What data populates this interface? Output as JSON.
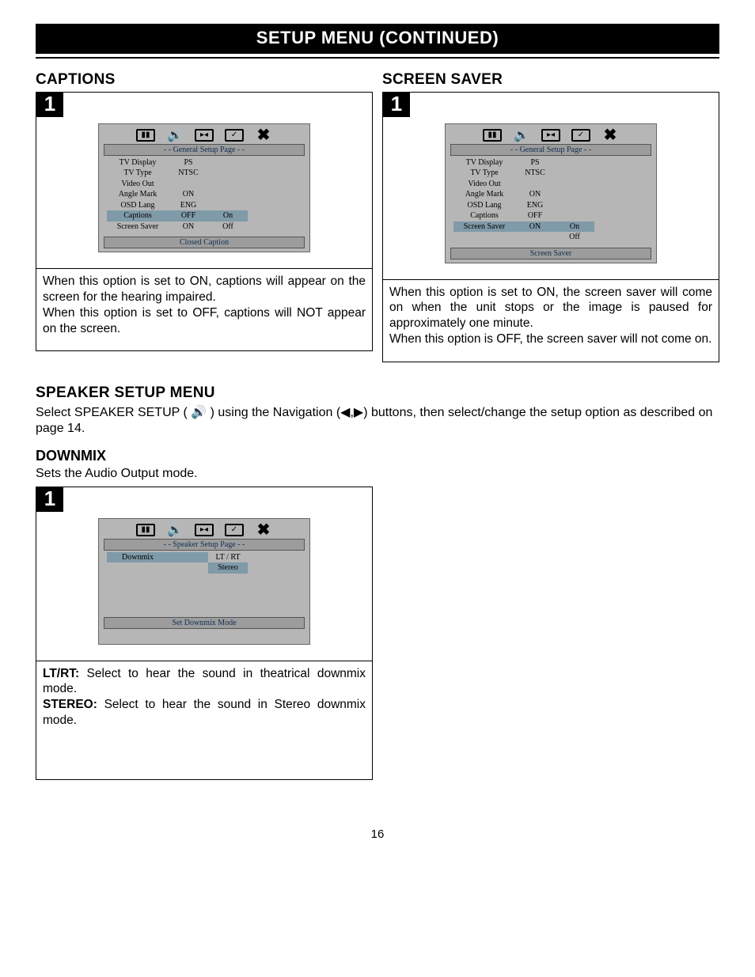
{
  "title": "SETUP MENU (CONTINUED)",
  "pageNumber": "16",
  "captions": {
    "heading": "CAPTIONS",
    "step": "1",
    "osd": {
      "header": "- - General Setup Page - -",
      "rows": [
        {
          "c1": "TV Display",
          "c2": "PS",
          "c3": ""
        },
        {
          "c1": "TV Type",
          "c2": "NTSC",
          "c3": ""
        },
        {
          "c1": "Video Out",
          "c2": "",
          "c3": ""
        },
        {
          "c1": "Angle Mark",
          "c2": "ON",
          "c3": ""
        },
        {
          "c1": "OSD Lang",
          "c2": "ENG",
          "c3": ""
        },
        {
          "c1": "Captions",
          "c2": "OFF",
          "c3": "On",
          "hlLeft": true,
          "hlC3": true
        },
        {
          "c1": "Screen Saver",
          "c2": "ON",
          "c3": "Off"
        }
      ],
      "footer": "Closed Caption"
    },
    "desc1": "When this option is set to ON, captions will appear on the screen for the hearing impaired.",
    "desc2": "When this option is set to OFF, captions will NOT appear on the screen."
  },
  "screenSaver": {
    "heading": "SCREEN SAVER",
    "step": "1",
    "osd": {
      "header": "- - General Setup Page - -",
      "rows": [
        {
          "c1": "TV Display",
          "c2": "PS",
          "c3": ""
        },
        {
          "c1": "TV Type",
          "c2": "NTSC",
          "c3": ""
        },
        {
          "c1": "Video Out",
          "c2": "",
          "c3": ""
        },
        {
          "c1": "Angle Mark",
          "c2": "ON",
          "c3": ""
        },
        {
          "c1": "OSD Lang",
          "c2": "ENG",
          "c3": ""
        },
        {
          "c1": "Captions",
          "c2": "OFF",
          "c3": ""
        },
        {
          "c1": "Screen Saver",
          "c2": "ON",
          "c3": "On",
          "hlLeft": true,
          "hlC3": true
        },
        {
          "c1": "",
          "c2": "",
          "c3": "Off"
        }
      ],
      "footer": "Screen Saver"
    },
    "desc1": "When this option is set to ON, the screen saver will come on when the unit stops or the image is paused for approximately one minute.",
    "desc2": "When this option is OFF, the screen saver will not come on."
  },
  "speakerSetup": {
    "heading": "SPEAKER SETUP MENU",
    "text_pre": "Select SPEAKER SETUP (",
    "text_mid": ") using the Navigation (",
    "text_post": ") buttons, then select/change the setup option as described on page 14."
  },
  "downmix": {
    "heading": "DOWNMIX",
    "intro": "Sets the Audio Output mode.",
    "step": "1",
    "osd": {
      "header": "- - Speaker Setup Page - -",
      "rows": [
        {
          "c1": "Downmix",
          "c2": "",
          "c3": "LT / RT",
          "hlLeft": true
        },
        {
          "c1": "",
          "c2": "",
          "c3": "Stereo",
          "hlC3": true
        }
      ],
      "footer": "Set Downmix Mode"
    },
    "desc_lt_label": "LT/RT:",
    "desc_lt": " Select to hear the sound in theatrical downmix mode.",
    "desc_st_label": "STEREO:",
    "desc_st": " Select to hear the sound in Stereo downmix mode."
  }
}
